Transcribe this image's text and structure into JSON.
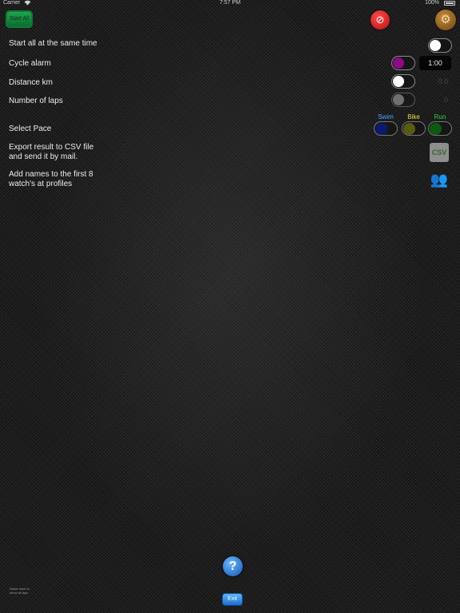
{
  "status_bar": {
    "carrier": "Carrier",
    "wifi_icon": "wifi-icon",
    "time": "7:57 PM",
    "battery": "100%"
  },
  "toolbar": {
    "start_all_label": "Start All",
    "stop_icon": "stop-icon",
    "settings_icon": "settings-gear-icon"
  },
  "settings": {
    "start_same_time": {
      "label": "Start all at the same time",
      "on": false
    },
    "cycle_alarm": {
      "label": "Cycle alarm",
      "on": false,
      "value": "1:00",
      "knob_color": "#8a0a8a"
    },
    "distance": {
      "label": "Distance km",
      "on": false,
      "value": "0.0"
    },
    "laps": {
      "label": "Number of laps",
      "on": false,
      "value": "0"
    }
  },
  "pace": {
    "label": "Select Pace",
    "options": [
      {
        "label": "Swim",
        "color": "#4aa8ff",
        "knob_color": "#0c1a6b"
      },
      {
        "label": "Bike",
        "color": "#e6e020",
        "knob_color": "#5a5a10"
      },
      {
        "label": "Run",
        "color": "#2fd33f",
        "knob_color": "#0d5a12"
      }
    ]
  },
  "export": {
    "label_line1": "Export result to CSV file",
    "label_line2": "and send it by mail.",
    "icon_text": "CSV"
  },
  "names": {
    "label_line1": "Add names to the first 8",
    "label_line2": "watch's at profiles"
  },
  "footer": {
    "help_label": "?",
    "exit_label": "Exit",
    "swipe_hint_line1": "Swipe back to",
    "swipe_hint_line2": "show all laps"
  }
}
